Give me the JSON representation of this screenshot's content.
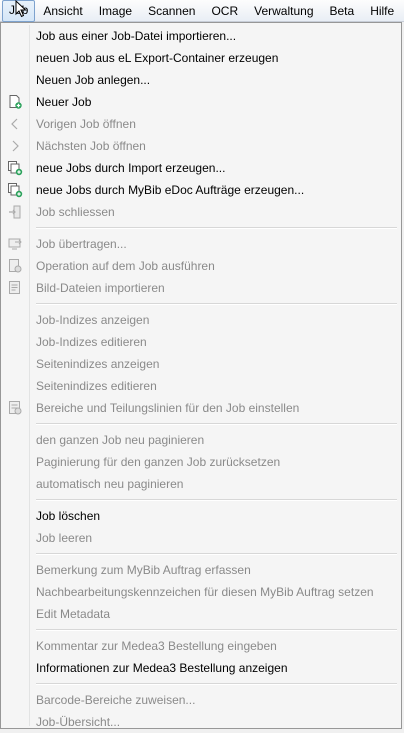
{
  "menubar": {
    "items": [
      "Job",
      "Ansicht",
      "Image",
      "Scannen",
      "OCR",
      "Verwaltung",
      "Beta",
      "Hilfe"
    ]
  },
  "menu": {
    "g1": [
      "Job aus einer Job-Datei importieren...",
      "neuen Job aus eL Export-Container erzeugen",
      "Neuen Job anlegen...",
      "Neuer Job",
      "Vorigen Job öffnen",
      "Nächsten Job öffnen",
      "neue Jobs durch Import erzeugen...",
      "neue Jobs durch MyBib eDoc Aufträge erzeugen...",
      "Job schliessen"
    ],
    "g2": [
      "Job übertragen...",
      "Operation auf dem Job ausführen",
      "Bild-Dateien importieren"
    ],
    "g3": [
      "Job-Indizes anzeigen",
      "Job-Indizes editieren",
      "Seitenindizes anzeigen",
      "Seitenindizes editieren",
      "Bereiche und Teilungslinien für den Job einstellen"
    ],
    "g4": [
      "den ganzen Job neu paginieren",
      "Paginierung für den ganzen Job zurücksetzen",
      "automatisch neu paginieren"
    ],
    "g5": [
      "Job löschen",
      "Job leeren"
    ],
    "g6": [
      "Bemerkung zum MyBib Auftrag erfassen",
      "Nachbearbeitungskennzeichen für diesen MyBib Auftrag setzen",
      "Edit Metadata"
    ],
    "g7": [
      "Kommentar zur Medea3 Bestellung eingeben",
      "Informationen zur Medea3 Bestellung anzeigen"
    ],
    "g8": [
      "Barcode-Bereiche zuweisen...",
      "Job-Übersicht..."
    ]
  },
  "colors": {
    "enabled_text": "#000000",
    "disabled_text": "#8a8a8a",
    "icon_green": "#2aa15a"
  }
}
